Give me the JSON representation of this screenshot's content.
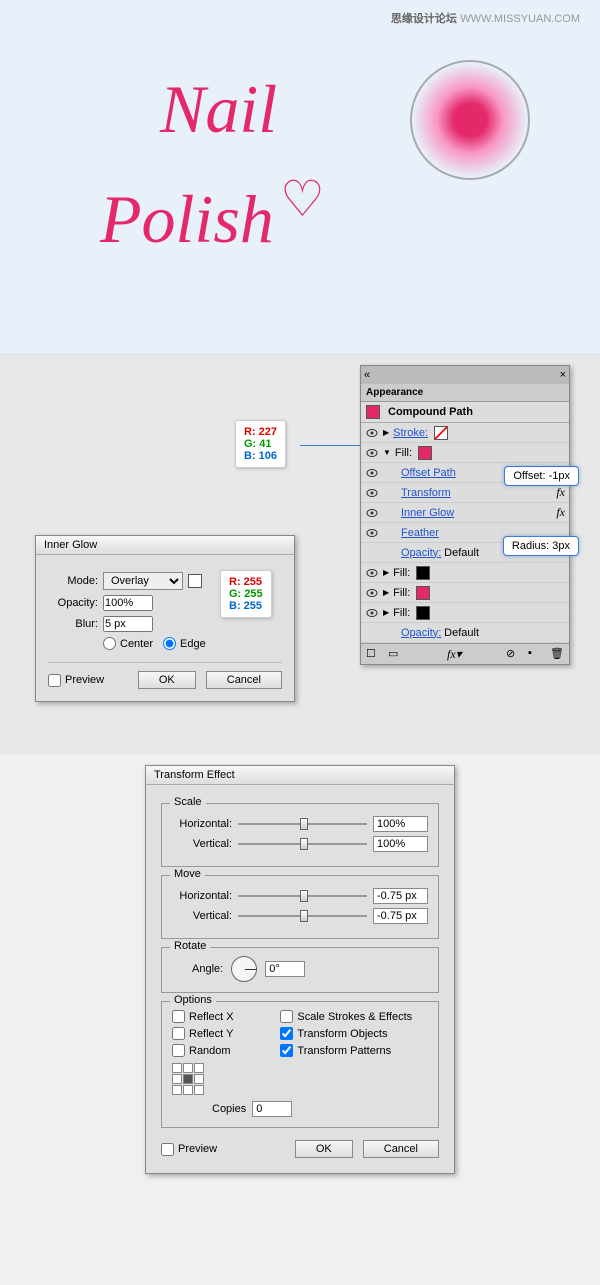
{
  "watermark": {
    "cn": "思缘设计论坛",
    "url": "WWW.MISSYUAN.COM"
  },
  "artwork": {
    "line1": "Nail",
    "line2": "Polish"
  },
  "rgb1": {
    "r": "R: 227",
    "g": "G: 41",
    "b": "B: 106"
  },
  "rgb2": {
    "r": "R: 255",
    "g": "G: 255",
    "b": "B: 255"
  },
  "appearance": {
    "tab": "Appearance",
    "title": "Compound Path",
    "stroke": "Stroke:",
    "fill": "Fill:",
    "offsetPath": "Offset Path",
    "transform": "Transform",
    "innerGlow": "Inner Glow",
    "feather": "Feather",
    "opacity": "Opacity:",
    "opacityDefault": "Default",
    "offsetCallout": "Offset: -1px",
    "radiusCallout": "Radius: 3px"
  },
  "innerGlow": {
    "title": "Inner Glow",
    "mode": "Mode:",
    "modeValue": "Overlay",
    "opacity": "Opacity:",
    "opacityValue": "100%",
    "blur": "Blur:",
    "blurValue": "5 px",
    "center": "Center",
    "edge": "Edge",
    "preview": "Preview",
    "ok": "OK",
    "cancel": "Cancel"
  },
  "transform": {
    "title": "Transform Effect",
    "scale": "Scale",
    "horizontal": "Horizontal:",
    "vertical": "Vertical:",
    "move": "Move",
    "rotate": "Rotate",
    "angle": "Angle:",
    "options": "Options",
    "reflectX": "Reflect X",
    "reflectY": "Reflect Y",
    "random": "Random",
    "scaleStrokes": "Scale Strokes & Effects",
    "transformObjects": "Transform Objects",
    "transformPatterns": "Transform Patterns",
    "copies": "Copies",
    "copiesValue": "0",
    "scaleH": "100%",
    "scaleV": "100%",
    "moveH": "-0.75 px",
    "moveV": "-0.75 px",
    "angleValue": "0°",
    "preview": "Preview",
    "ok": "OK",
    "cancel": "Cancel"
  }
}
